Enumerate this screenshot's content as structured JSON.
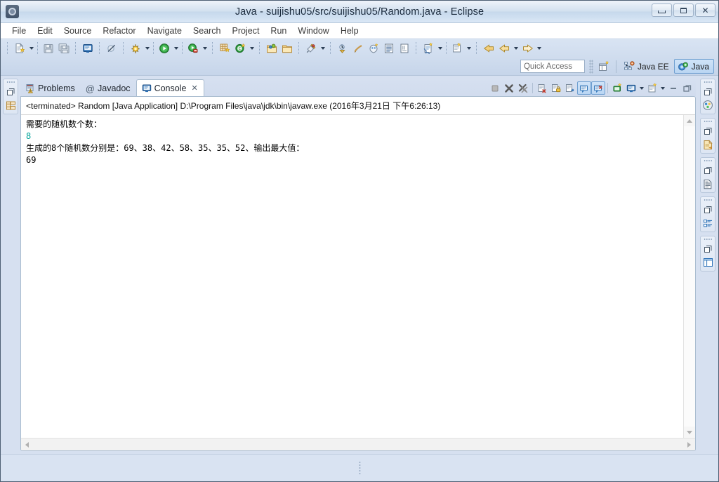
{
  "window": {
    "title": "Java - suijishu05/src/suijishu05/Random.java - Eclipse",
    "app_icon": "eclipse-icon",
    "controls": {
      "minimize": "Minimize",
      "maximize": "Maximize",
      "close": "Close"
    }
  },
  "menubar": {
    "items": [
      {
        "label": "File"
      },
      {
        "label": "Edit"
      },
      {
        "label": "Source"
      },
      {
        "label": "Refactor"
      },
      {
        "label": "Navigate"
      },
      {
        "label": "Search"
      },
      {
        "label": "Project"
      },
      {
        "label": "Run"
      },
      {
        "label": "Window"
      },
      {
        "label": "Help"
      }
    ]
  },
  "toolbar": {
    "groups": [
      {
        "name": "file-group",
        "buttons": [
          {
            "name": "new-wizard",
            "icon": "new-file-icon",
            "has_dropdown": true
          },
          {
            "name": "save",
            "icon": "save-icon",
            "has_dropdown": false
          },
          {
            "name": "save-all",
            "icon": "save-all-icon",
            "has_dropdown": false
          }
        ]
      },
      {
        "name": "print-group",
        "buttons": [
          {
            "name": "print",
            "icon": "print-icon",
            "has_dropdown": false
          }
        ]
      },
      {
        "name": "marker-group",
        "buttons": [
          {
            "name": "skip-all-breakpoints",
            "icon": "breakpoint-skip-icon",
            "has_dropdown": false
          }
        ]
      },
      {
        "name": "launch-group",
        "buttons": [
          {
            "name": "debug",
            "icon": "debug-bug-icon",
            "has_dropdown": true
          },
          {
            "name": "run",
            "icon": "run-play-icon",
            "has_dropdown": true
          },
          {
            "name": "run-external-tools",
            "icon": "external-tools-icon",
            "has_dropdown": true
          }
        ]
      },
      {
        "name": "java-group",
        "buttons": [
          {
            "name": "new-java-package",
            "icon": "new-package-icon",
            "has_dropdown": false
          },
          {
            "name": "new-java-class",
            "icon": "new-class-icon",
            "has_dropdown": true
          }
        ]
      },
      {
        "name": "open-group",
        "buttons": [
          {
            "name": "open-type",
            "icon": "open-type-icon",
            "has_dropdown": false
          },
          {
            "name": "open-task",
            "icon": "open-task-icon",
            "has_dropdown": false
          }
        ]
      },
      {
        "name": "search-group",
        "buttons": [
          {
            "name": "search",
            "icon": "search-icon",
            "has_dropdown": true
          }
        ]
      },
      {
        "name": "annotation-group",
        "buttons": [
          {
            "name": "next-annotation",
            "icon": "next-annotation-icon",
            "has_dropdown": false
          },
          {
            "name": "previous-annotation",
            "icon": "prev-annotation-icon",
            "has_dropdown": false
          },
          {
            "name": "toggle-mark-occurrences",
            "icon": "mark-occurrences-icon",
            "has_dropdown": false
          },
          {
            "name": "toggle-block-selection",
            "icon": "block-selection-icon",
            "has_dropdown": false
          },
          {
            "name": "toggle-whitespace",
            "icon": "show-whitespace-icon",
            "has_dropdown": false
          }
        ]
      },
      {
        "name": "editor-group",
        "buttons": [
          {
            "name": "new-java-element",
            "icon": "new-element-icon",
            "has_dropdown": true
          },
          {
            "name": "restore-editor",
            "icon": "restore-editor-icon",
            "has_dropdown": true
          }
        ]
      },
      {
        "name": "navigation-group",
        "buttons": [
          {
            "name": "back-history",
            "icon": "back-arrow-icon",
            "has_dropdown": false
          },
          {
            "name": "forward-history",
            "icon": "forward-arrow-icon",
            "has_dropdown": true
          },
          {
            "name": "next-edit-location",
            "icon": "next-edit-arrow-icon",
            "has_dropdown": true
          }
        ]
      }
    ]
  },
  "quick_access": {
    "placeholder": "Quick Access",
    "value": ""
  },
  "perspectives": {
    "open_button": {
      "name": "open-perspective",
      "icon": "open-perspective-icon"
    },
    "items": [
      {
        "label": "Java EE",
        "icon": "java-ee-perspective-icon",
        "active": false
      },
      {
        "label": "Java",
        "icon": "java-perspective-icon",
        "active": true
      }
    ]
  },
  "left_rail": {
    "groups": [
      {
        "name": "package-explorer-fastview",
        "restore_icon": "restore-view-icon",
        "view_icon": "package-explorer-icon"
      }
    ]
  },
  "right_rail": {
    "groups": [
      {
        "name": "outline-fastview",
        "restore_icon": "restore-view-icon",
        "view_icon": "palette-icon"
      },
      {
        "name": "task-list-fastview",
        "restore_icon": "restore-view-icon",
        "view_icon": "task-list-icon"
      },
      {
        "name": "snippets-fastview",
        "restore_icon": "restore-view-icon",
        "view_icon": "document-icon"
      },
      {
        "name": "outline-tree-fastview",
        "restore_icon": "restore-view-icon",
        "view_icon": "outline-tree-icon"
      },
      {
        "name": "layout-fastview",
        "restore_icon": "restore-view-icon",
        "view_icon": "layout-panel-icon"
      }
    ]
  },
  "view_tabs": {
    "tabs": [
      {
        "label": "Problems",
        "icon": "problems-icon",
        "active": false,
        "closable": false
      },
      {
        "label": "Javadoc",
        "icon": "javadoc-at-icon",
        "active": false,
        "closable": false
      },
      {
        "label": "Console",
        "icon": "console-icon",
        "active": true,
        "closable": true,
        "close_glyph": "✕"
      }
    ],
    "tools": [
      {
        "name": "terminate-button",
        "icon": "terminate-stop-icon",
        "enabled": false,
        "toggled": false
      },
      {
        "name": "remove-launch-button",
        "icon": "remove-launch-icon",
        "enabled": true,
        "toggled": false
      },
      {
        "name": "remove-all-terminated-button",
        "icon": "remove-all-terminated-icon",
        "enabled": true,
        "toggled": false
      },
      {
        "name": "clear-console-button",
        "icon": "clear-console-icon",
        "enabled": true,
        "toggled": false
      },
      {
        "name": "scroll-lock-button",
        "icon": "scroll-lock-icon",
        "enabled": true,
        "toggled": false
      },
      {
        "name": "word-wrap-button",
        "icon": "word-wrap-icon",
        "enabled": true,
        "toggled": false
      },
      {
        "name": "show-console-on-output-button",
        "icon": "show-on-output-icon",
        "enabled": true,
        "toggled": true
      },
      {
        "name": "show-console-on-error-button",
        "icon": "show-on-error-icon",
        "enabled": true,
        "toggled": true
      },
      {
        "name": "pin-console-button",
        "icon": "pin-console-icon",
        "enabled": true,
        "toggled": false
      },
      {
        "name": "display-selected-console-button",
        "icon": "display-console-icon",
        "enabled": true,
        "toggled": false,
        "has_dropdown": true
      },
      {
        "name": "open-console-button",
        "icon": "open-console-icon",
        "enabled": true,
        "toggled": false,
        "has_dropdown": true
      },
      {
        "name": "minimize-view-button",
        "icon": "minimize-icon",
        "enabled": true,
        "toggled": false
      },
      {
        "name": "maximize-view-button",
        "icon": "maximize-icon",
        "enabled": true,
        "toggled": false
      }
    ]
  },
  "console": {
    "header": "<terminated> Random [Java Application] D:\\Program Files\\java\\jdk\\bin\\javaw.exe (2016年3月21日 下午6:26:13)",
    "lines": [
      {
        "text": "需要的随机数个数：",
        "style": "output"
      },
      {
        "text": "8",
        "style": "input-echo"
      },
      {
        "text": "生成的8个随机数分别是：69、38、42、58、35、35、52、输出最大值：",
        "style": "output"
      },
      {
        "text": "69",
        "style": "output"
      }
    ],
    "scroll": {
      "vertical_up": "▲",
      "vertical_down": "▼",
      "horizontal_left": "◀",
      "horizontal_right": "▶"
    }
  },
  "status_bar": {
    "text": ""
  },
  "colors": {
    "title_bar_top": "#eef3fa",
    "title_bar_bottom": "#dbe8f6",
    "toolbar_bg": "#cfdcee",
    "workbench_bg": "#d6e0f0",
    "console_bg": "#ffffff",
    "console_text": "#000000",
    "input_echo": "#00a39a",
    "active_highlight": "#6f9fd0",
    "tab_active_bg": "#ffffff"
  }
}
